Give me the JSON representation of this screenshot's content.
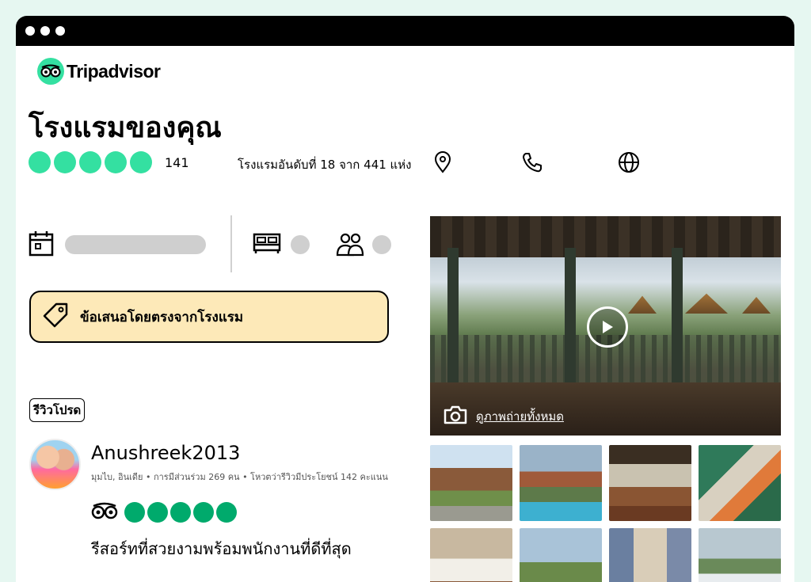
{
  "app": {
    "logo_text": "Tripadvisor",
    "logo_icon": "owl-eyes-icon"
  },
  "hotel": {
    "name": "โรงแรมของคุณ",
    "rating_bubbles": 5,
    "review_count": "141",
    "ranking": "โรงแรมอันดับที่ 18 จาก 441 แห่ง",
    "accent_color": "#34e0a1"
  },
  "actions": {
    "location_icon": "map-pin-icon",
    "phone_icon": "phone-icon",
    "web_icon": "globe-icon"
  },
  "search": {
    "calendar_icon": "calendar-icon",
    "bed_icon": "bed-icon",
    "guests_icon": "people-icon"
  },
  "offer": {
    "label": "ข้อเสนอโดยตรงจากโรงแรม",
    "icon": "price-tag-icon",
    "bg_color": "#fde9b8"
  },
  "review": {
    "badge": "รีวิวโปรด",
    "username": "Anushreek2013",
    "meta": "มุมไบ, อินเดีย • การมีส่วนร่วม 269 คน • โหวตว่ารีวิวมีประโยชน์ 142 คะแนน",
    "rating_bubbles": 5,
    "bubble_color": "#00aa6c",
    "title": "รีสอร์ทที่สวยงามพร้อมพนักงานที่ดีที่สุด"
  },
  "gallery": {
    "view_all_label": "ดูภาพถ่ายทั้งหมด",
    "camera_icon": "camera-icon",
    "play_icon": "play-icon",
    "thumbnail_count": 8
  }
}
